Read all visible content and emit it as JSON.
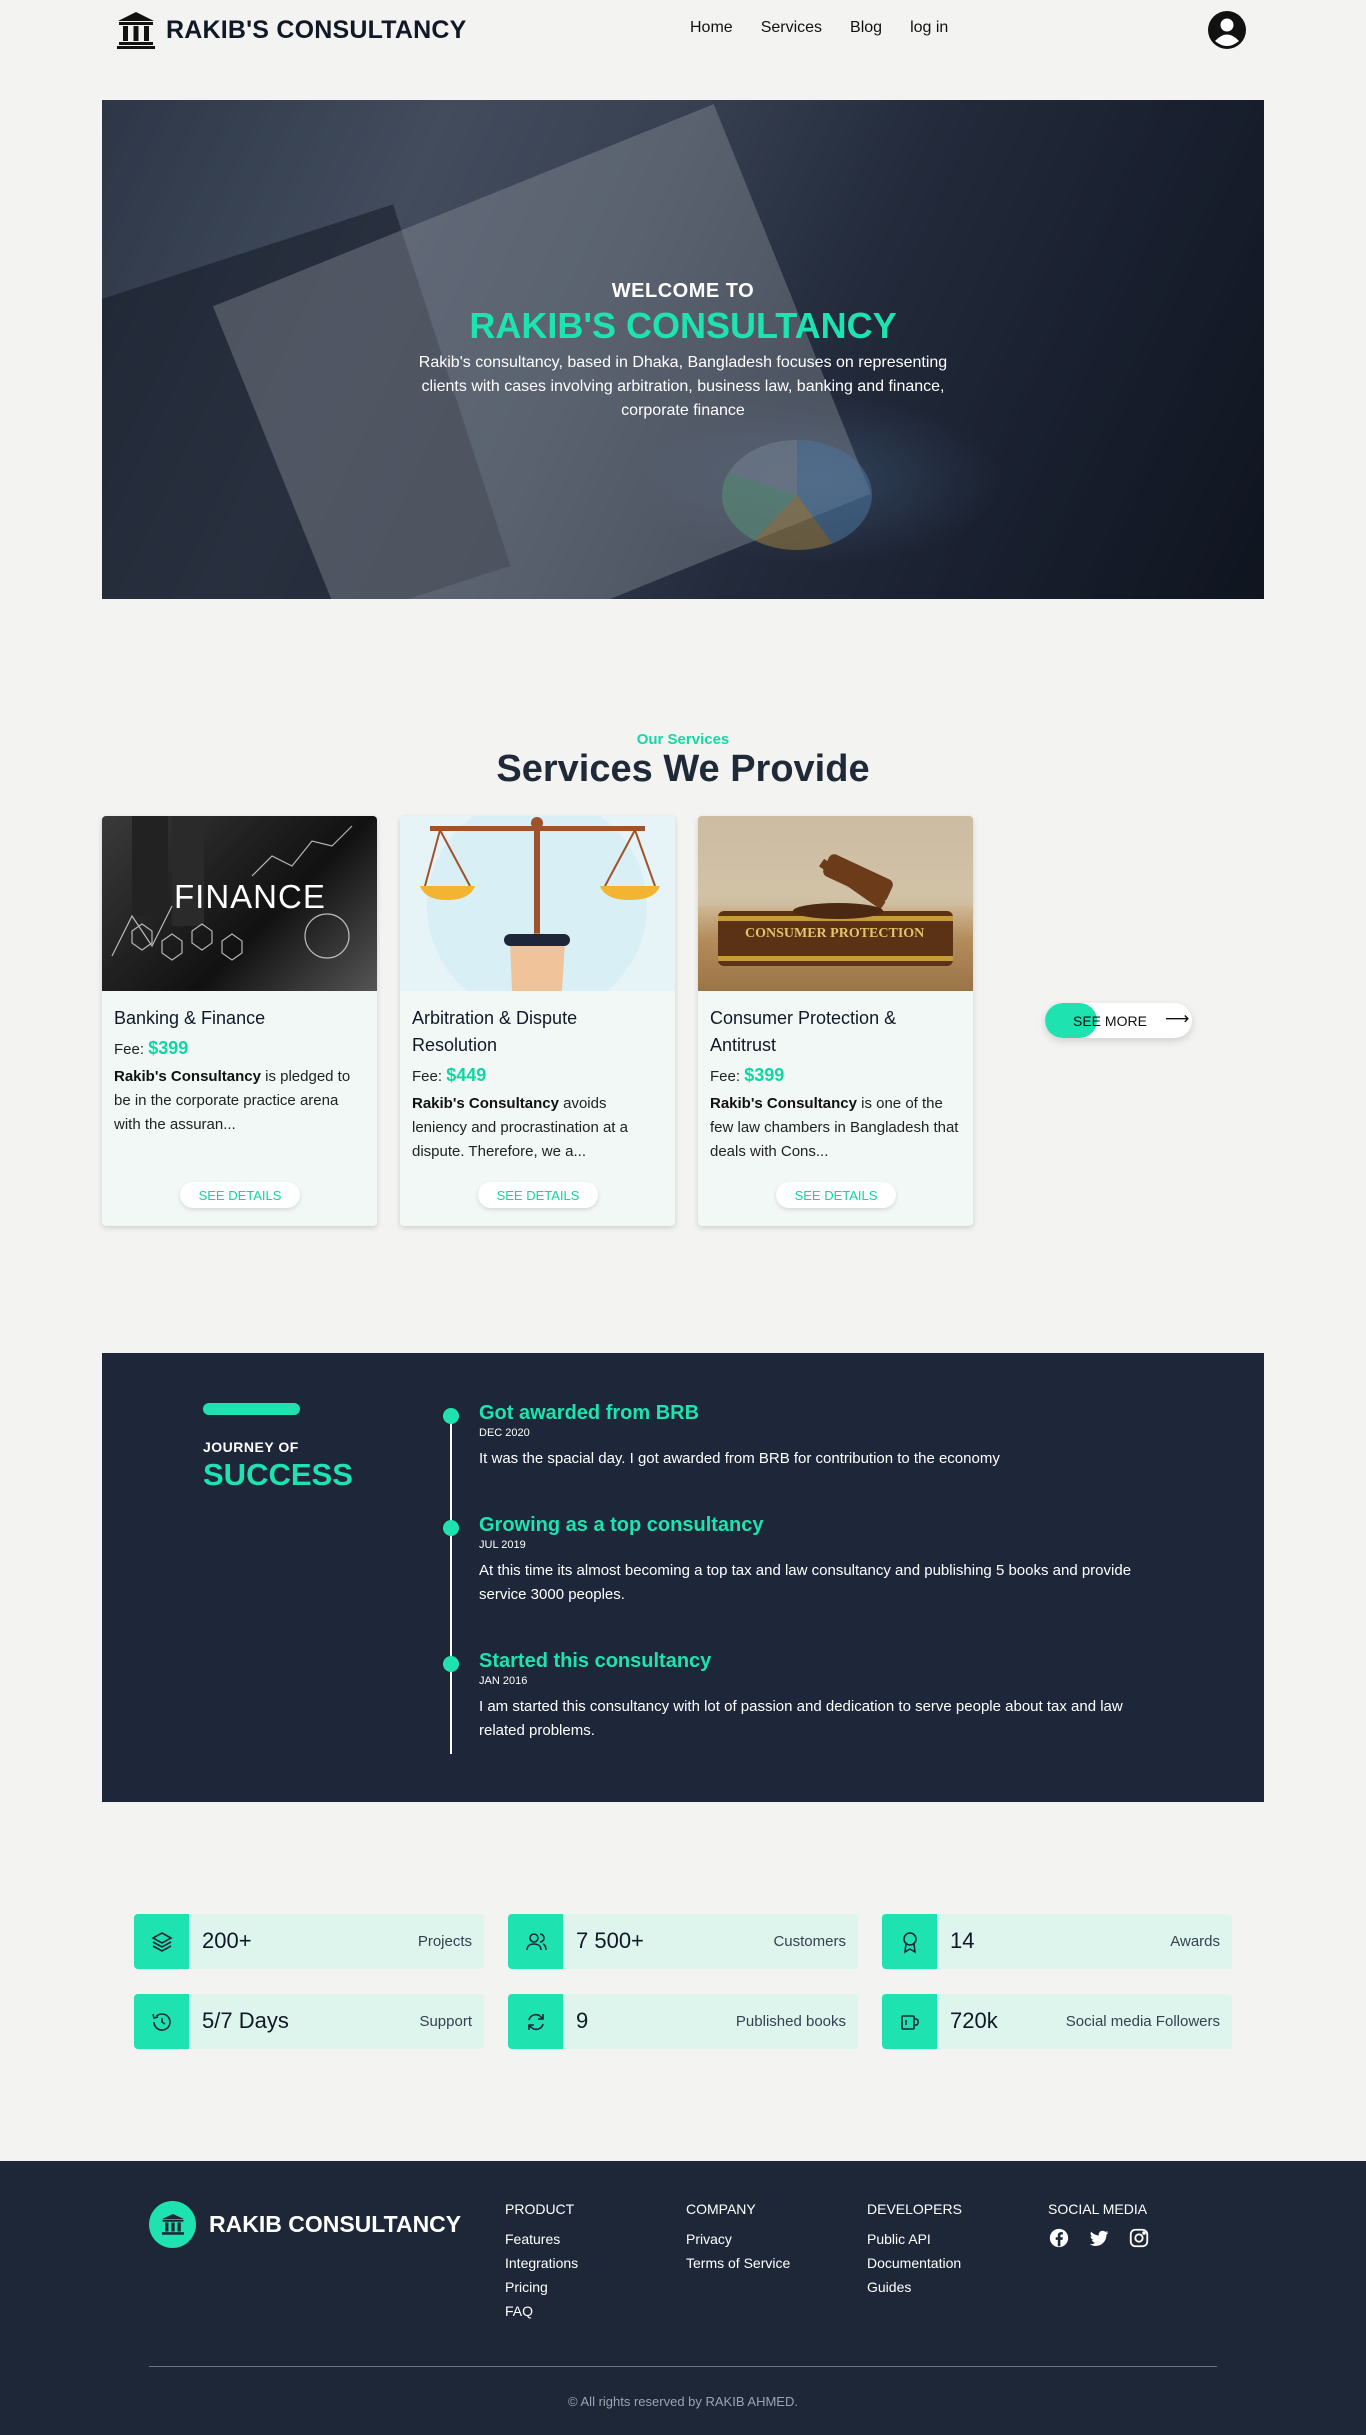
{
  "nav": {
    "brand": "RAKIB'S CONSULTANCY",
    "brand_icon": "bank-icon",
    "links": [
      "Home",
      "Services",
      "Blog",
      "log in"
    ],
    "avatar_icon": "user-avatar-icon"
  },
  "hero": {
    "welcome": "WELCOME TO",
    "title": "RAKIB'S CONSULTANCY",
    "description": "Rakib's consultancy, based in Dhaka, Bangladesh focuses on representing clients with cases involving arbitration, business law, banking and finance, corporate finance"
  },
  "services": {
    "eyebrow": "Our Services",
    "title": "Services We Provide",
    "fee_label": "Fee:",
    "details_label": "SEE DETAILS",
    "see_more": "SEE MORE",
    "cards": [
      {
        "title": "Banking & Finance",
        "fee": "$399",
        "brand": "Rakib's Consultancy",
        "desc": " is pledged to be in the corporate practice arena with the assuran...",
        "image_text": "FINANCE"
      },
      {
        "title": "Arbitration & Dispute Resolution",
        "fee": "$449",
        "brand": "Rakib's Consultancy",
        "desc": " avoids leniency and procrastination at a dispute. Therefore, we a..."
      },
      {
        "title": "Consumer Protection & Antitrust",
        "fee": "$399",
        "brand": "Rakib's Consultancy",
        "desc": " is one of the few law chambers in Bangladesh that deals with Cons...",
        "image_text": "CONSUMER PROTECTION"
      }
    ]
  },
  "journey": {
    "subtitle": "JOURNEY OF",
    "title": "SUCCESS",
    "items": [
      {
        "title": "Got awarded from BRB",
        "date": "DEC 2020",
        "text": "It was the spacial day. I got awarded from BRB for contribution to the economy"
      },
      {
        "title": "Growing as a top consultancy",
        "date": "JUL 2019",
        "text": "At this time its almost becoming a top tax and law consultancy and publishing 5 books and provide service 3000 peoples."
      },
      {
        "title": "Started this consultancy",
        "date": "JAN 2016",
        "text": "I am started this consultancy with lot of passion and dedication to serve people about tax and law related problems."
      }
    ]
  },
  "stats": [
    {
      "icon": "layers-icon",
      "value": "200+",
      "label": "Projects"
    },
    {
      "icon": "users-icon",
      "value": "7 500+",
      "label": "Customers"
    },
    {
      "icon": "award-icon",
      "value": "14",
      "label": "Awards"
    },
    {
      "icon": "history-icon",
      "value": "5/7 Days",
      "label": "Support"
    },
    {
      "icon": "refresh-icon",
      "value": "9",
      "label": "Published books"
    },
    {
      "icon": "mug-icon",
      "value": "720k",
      "label": "Social media Followers"
    }
  ],
  "footer": {
    "brand": "RAKIB CONSULTANCY",
    "columns": [
      {
        "heading": "PRODUCT",
        "links": [
          "Features",
          "Integrations",
          "Pricing",
          "FAQ"
        ]
      },
      {
        "heading": "COMPANY",
        "links": [
          "Privacy",
          "Terms of Service"
        ]
      },
      {
        "heading": "DEVELOPERS",
        "links": [
          "Public API",
          "Documentation",
          "Guides"
        ]
      }
    ],
    "social_heading": "SOCIAL MEDIA",
    "social_icons": [
      "facebook-icon",
      "twitter-icon",
      "instagram-icon"
    ],
    "copyright": "© All rights reserved by RAKIB AHMED."
  },
  "colors": {
    "accent": "#1ee3b0",
    "dark": "#1e2739",
    "background": "#f3f3f1"
  }
}
